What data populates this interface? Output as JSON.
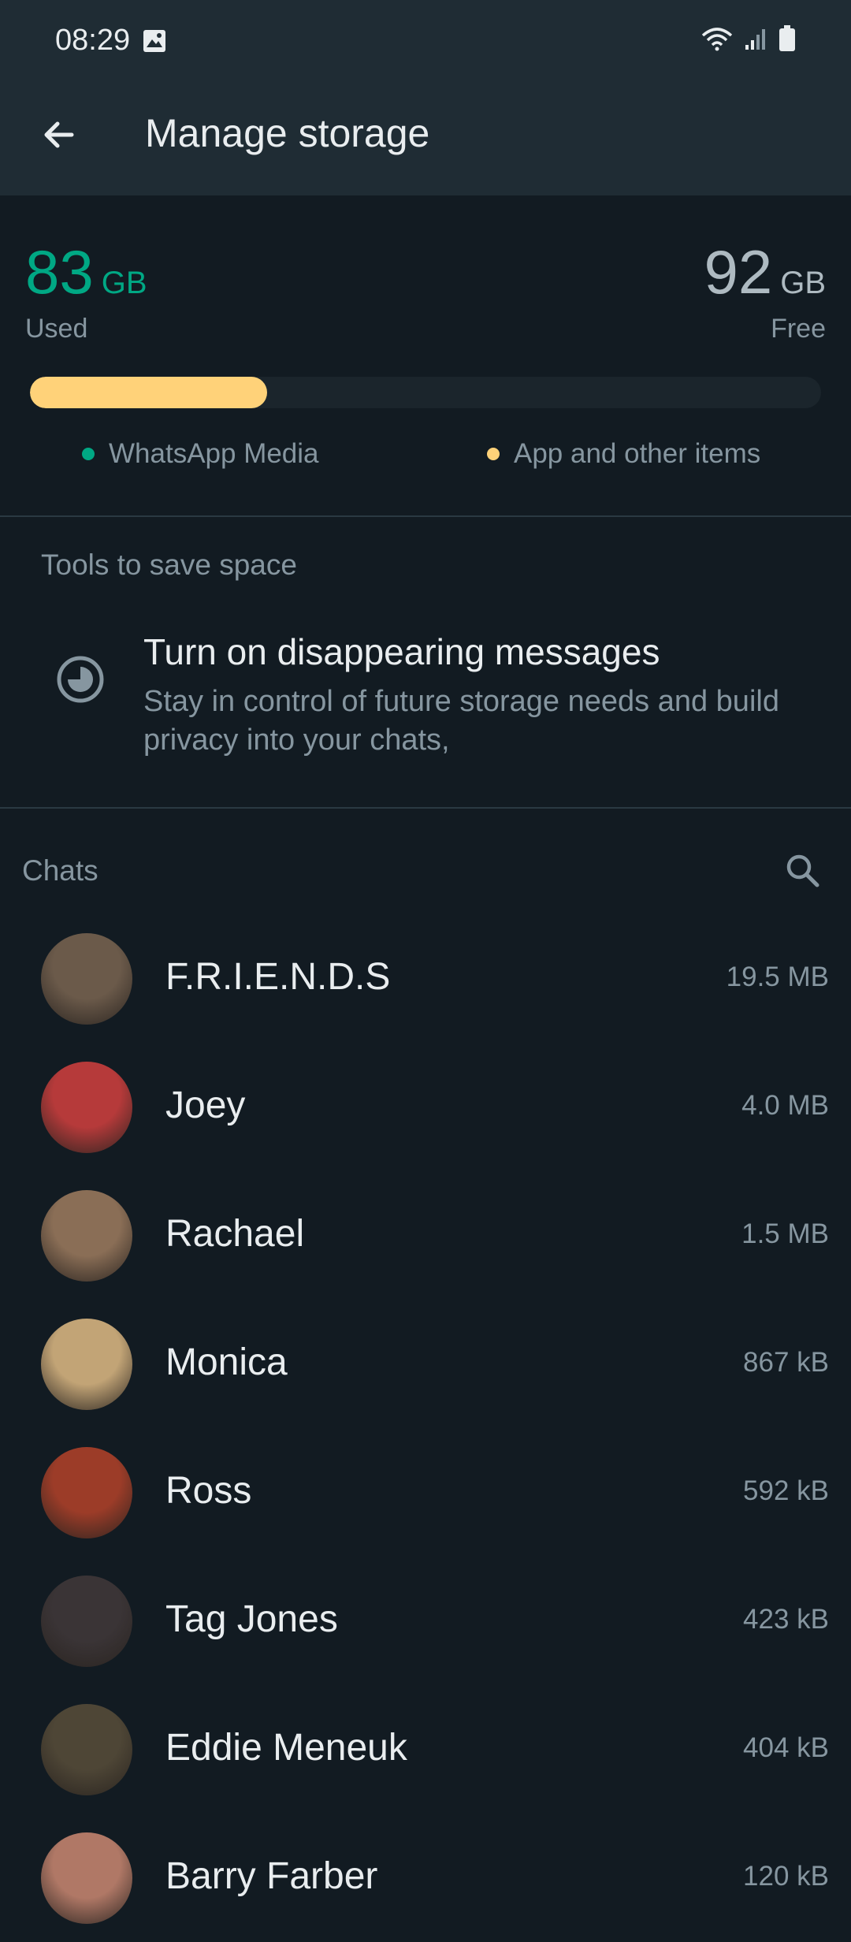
{
  "status_bar": {
    "time": "08:29",
    "icons": [
      "gallery-icon",
      "wifi-icon",
      "signal-icon",
      "battery-icon"
    ]
  },
  "app_bar": {
    "back_icon": "arrow-left-icon",
    "title": "Manage storage"
  },
  "storage": {
    "used_value": "83",
    "used_unit": "GB",
    "used_label": "Used",
    "free_value": "92",
    "free_unit": "GB",
    "free_label": "Free",
    "bar_fill_fraction": 0.3,
    "colors": {
      "media": "#00a884",
      "app": "#ffd279",
      "used_text": "#00a884"
    },
    "legend": [
      {
        "label": "WhatsApp Media",
        "color": "#00a884"
      },
      {
        "label": "App and other items",
        "color": "#ffd279"
      }
    ]
  },
  "tools": {
    "header": "Tools to save space",
    "items": [
      {
        "icon": "disappearing-timer-icon",
        "title": "Turn on disappearing messages",
        "description": "Stay in control of future storage needs and build privacy into your chats,"
      }
    ]
  },
  "chats": {
    "header": "Chats",
    "search_icon": "search-icon",
    "items": [
      {
        "name": "F.R.I.E.N.D.S",
        "size": "19.5 MB",
        "avatar_color": "#6b5a4a"
      },
      {
        "name": "Joey",
        "size": "4.0 MB",
        "avatar_color": "#b63a3a"
      },
      {
        "name": "Rachael",
        "size": "1.5 MB",
        "avatar_color": "#8a6e56"
      },
      {
        "name": "Monica",
        "size": "867 kB",
        "avatar_color": "#c2a476"
      },
      {
        "name": "Ross",
        "size": "592 kB",
        "avatar_color": "#9c3c28"
      },
      {
        "name": "Tag Jones",
        "size": "423 kB",
        "avatar_color": "#3a3436"
      },
      {
        "name": "Eddie Meneuk",
        "size": "404 kB",
        "avatar_color": "#4e4636"
      },
      {
        "name": "Barry Farber",
        "size": "120 kB",
        "avatar_color": "#b07866"
      }
    ]
  }
}
